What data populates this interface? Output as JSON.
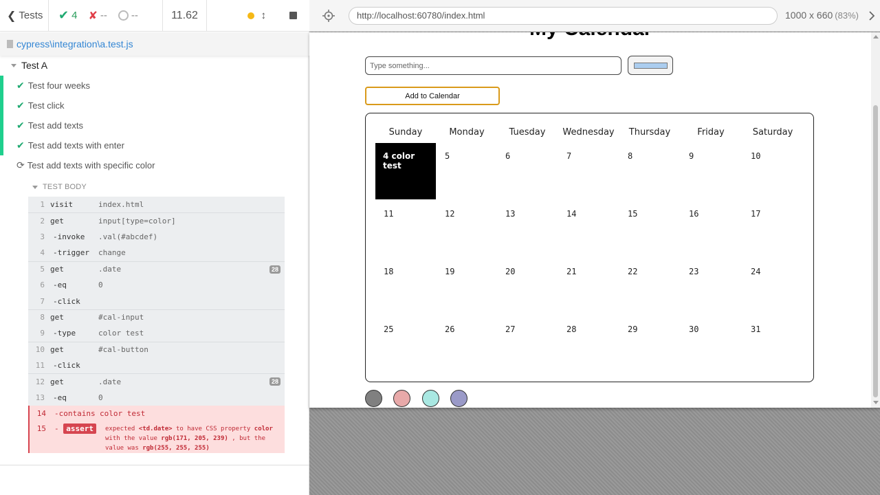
{
  "runner": {
    "back_label": "Tests",
    "passed": "4",
    "failed": "--",
    "pending": "--",
    "duration": "11.62",
    "spec_path": "cypress\\integration\\a.test.js"
  },
  "suite": {
    "title": "Test A",
    "tests": [
      {
        "label": "Test four weeks",
        "state": "passed"
      },
      {
        "label": "Test click",
        "state": "passed"
      },
      {
        "label": "Test add texts",
        "state": "passed"
      },
      {
        "label": "Test add texts with enter",
        "state": "passed"
      },
      {
        "label": "Test add texts with specific color",
        "state": "running"
      }
    ],
    "body_label": "TEST BODY",
    "commands": [
      {
        "n": "1",
        "name": "visit",
        "msg": "index.html"
      },
      {
        "n": "2",
        "name": "get",
        "msg": "input[type=color]"
      },
      {
        "n": "3",
        "name": "-invoke",
        "msg": ".val(#abcdef)"
      },
      {
        "n": "4",
        "name": "-trigger",
        "msg": "change"
      },
      {
        "n": "5",
        "name": "get",
        "msg": ".date",
        "badge": "28"
      },
      {
        "n": "6",
        "name": "-eq",
        "msg": "0"
      },
      {
        "n": "7",
        "name": "-click",
        "msg": ""
      },
      {
        "n": "8",
        "name": "get",
        "msg": "#cal-input"
      },
      {
        "n": "9",
        "name": "-type",
        "msg": "color test"
      },
      {
        "n": "10",
        "name": "get",
        "msg": "#cal-button"
      },
      {
        "n": "11",
        "name": "-click",
        "msg": ""
      },
      {
        "n": "12",
        "name": "get",
        "msg": ".date",
        "badge": "28"
      },
      {
        "n": "13",
        "name": "-eq",
        "msg": "0"
      },
      {
        "n": "14",
        "name": "-contains",
        "msg": "color test"
      },
      {
        "n": "15",
        "name": "-",
        "msg": ""
      }
    ],
    "assert_label": "assert",
    "assert_error": {
      "p1": "expected",
      "target": "<td.date>",
      "p2": "to have CSS property",
      "prop": "color",
      "p3": "with the value",
      "expected": "rgb(171, 205, 239)",
      "p4": ", but the value was",
      "actual": "rgb(255, 255, 255)"
    }
  },
  "browser": {
    "url": "http://localhost:60780/index.html",
    "viewport": "1000 x 660",
    "zoom": "(83%)"
  },
  "app": {
    "title": "My Calendar",
    "input_placeholder": "Type something...",
    "color_value": "#abcdef",
    "add_button": "Add to Calendar",
    "days": [
      "Sunday",
      "Monday",
      "Tuesday",
      "Wednesday",
      "Thursday",
      "Friday",
      "Saturday"
    ],
    "dates": [
      [
        "4 color test",
        "5",
        "6",
        "7",
        "8",
        "9",
        "10"
      ],
      [
        "11",
        "12",
        "13",
        "14",
        "15",
        "16",
        "17"
      ],
      [
        "18",
        "19",
        "20",
        "21",
        "22",
        "23",
        "24"
      ],
      [
        "25",
        "26",
        "27",
        "28",
        "29",
        "30",
        "31"
      ]
    ],
    "palette": [
      "#808080",
      "#e8a9a9",
      "#a9e8e2",
      "#9a9ac8"
    ]
  }
}
